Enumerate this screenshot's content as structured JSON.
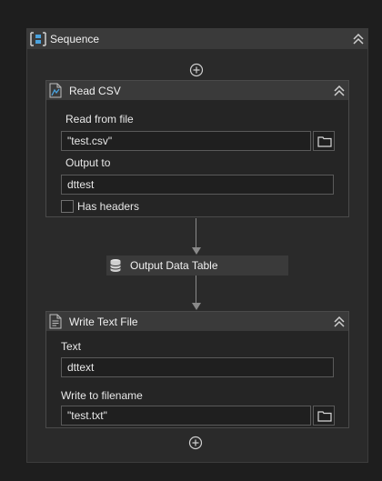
{
  "sequence": {
    "title": "Sequence",
    "icon": "sequence-icon",
    "collapse_icon": "double-chevron-up-icon",
    "add_icon": "plus-circle-icon"
  },
  "read_csv": {
    "title": "Read CSV",
    "icon": "csv-file-icon",
    "read_from_label": "Read from file",
    "read_from_value": "\"test.csv\"",
    "output_to_label": "Output to",
    "output_to_value": "dttest",
    "has_headers_label": "Has headers",
    "has_headers_checked": false
  },
  "output_data_table": {
    "title": "Output Data Table",
    "icon": "database-icon"
  },
  "write_text_file": {
    "title": "Write Text File",
    "icon": "text-file-icon",
    "text_label": "Text",
    "text_value": "dttext",
    "filename_label": "Write to filename",
    "filename_value": "\"test.txt\""
  },
  "colors": {
    "background": "#1e1e1e",
    "panel": "#2a2a2a",
    "header": "#3a3a3a",
    "icon_accent": "#4aa3df"
  }
}
